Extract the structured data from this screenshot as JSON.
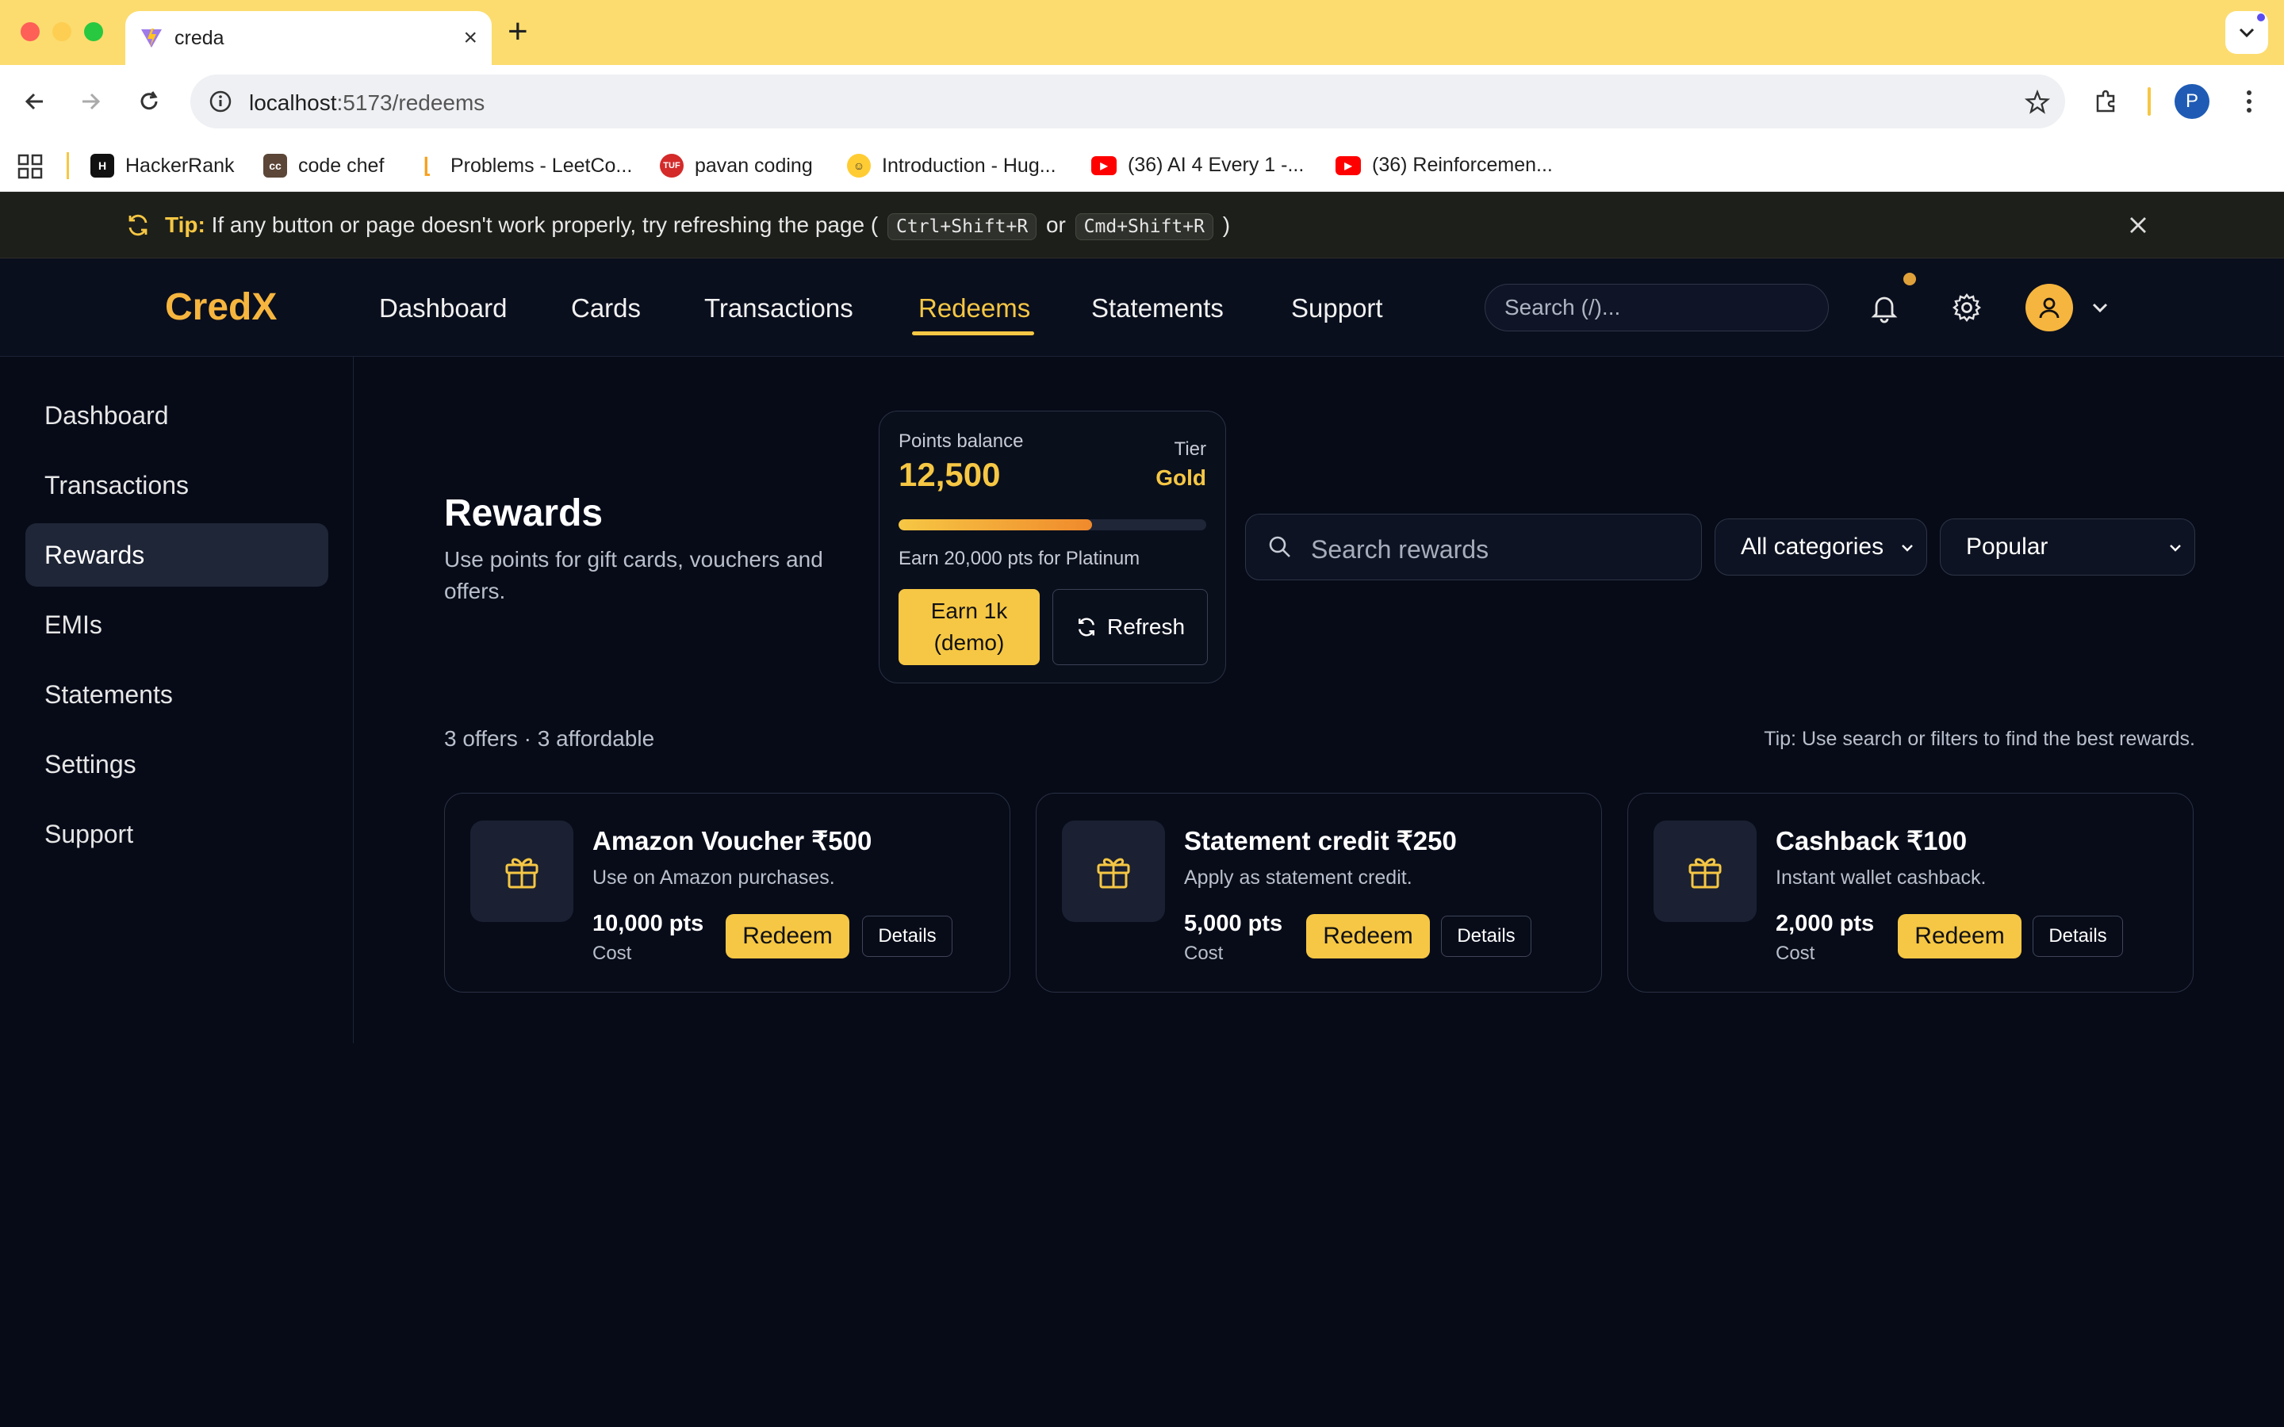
{
  "browser": {
    "tab_title": "creda",
    "url_host": "localhost",
    "url_path": ":5173/redeems",
    "profile_initial": "P",
    "bookmarks": [
      {
        "label": "HackerRank",
        "icon": "hackerrank-icon",
        "color": "#1ba94c"
      },
      {
        "label": "code chef",
        "icon": "codechef-icon",
        "color": "#5b4638"
      },
      {
        "label": "Problems - LeetCo...",
        "icon": "leetcode-icon",
        "color": "#f89f1b"
      },
      {
        "label": "pavan coding",
        "icon": "tuf-icon",
        "color": "#d42a2a"
      },
      {
        "label": "Introduction - Hug...",
        "icon": "huggingface-icon",
        "color": "#ffcc33"
      },
      {
        "label": "(36) AI 4 Every 1 -...",
        "icon": "youtube-icon",
        "color": "#ff0000"
      },
      {
        "label": "(36) Reinforcemen...",
        "icon": "youtube-icon",
        "color": "#ff0000"
      }
    ]
  },
  "tip_banner": {
    "label": "Tip:",
    "text": "If any button or page doesn't work properly, try refreshing the page (",
    "kbd1": "Ctrl+Shift+R",
    "or": "or",
    "kbd2": "Cmd+Shift+R",
    "close_paren": ")"
  },
  "header": {
    "logo": "CredX",
    "nav": [
      "Dashboard",
      "Cards",
      "Transactions",
      "Redeems",
      "Statements",
      "Support"
    ],
    "active_nav": "Redeems",
    "search_placeholder": "Search (/)..."
  },
  "sidebar": {
    "items": [
      "Dashboard",
      "Transactions",
      "Rewards",
      "EMIs",
      "Statements",
      "Settings",
      "Support"
    ],
    "active": "Rewards"
  },
  "page": {
    "title": "Rewards",
    "subtitle": "Use points for gift cards, vouchers and offers."
  },
  "points": {
    "label": "Points balance",
    "value": "12,500",
    "tier_label": "Tier",
    "tier": "Gold",
    "progress": 0.63,
    "hint": "Earn 20,000 pts for Platinum",
    "earn_button": "Earn 1k (demo)",
    "refresh_button": "Refresh"
  },
  "filters": {
    "search_placeholder": "Search rewards",
    "category": "All categories",
    "sort": "Popular"
  },
  "summary": {
    "count": "3 offers · 3 affordable",
    "tip": "Tip: Use search or filters to find the best rewards."
  },
  "offers": [
    {
      "title": "Amazon Voucher ₹500",
      "desc": "Use on Amazon purchases.",
      "points": "10,000 pts",
      "cost_label": "Cost",
      "redeem": "Redeem",
      "details": "Details"
    },
    {
      "title": "Statement credit ₹250",
      "desc": "Apply as statement credit.",
      "points": "5,000 pts",
      "cost_label": "Cost",
      "redeem": "Redeem",
      "details": "Details"
    },
    {
      "title": "Cashback ₹100",
      "desc": "Instant wallet cashback.",
      "points": "2,000 pts",
      "cost_label": "Cost",
      "redeem": "Redeem",
      "details": "Details"
    }
  ],
  "colors": {
    "accent": "#f6c744",
    "background": "#070b18"
  }
}
